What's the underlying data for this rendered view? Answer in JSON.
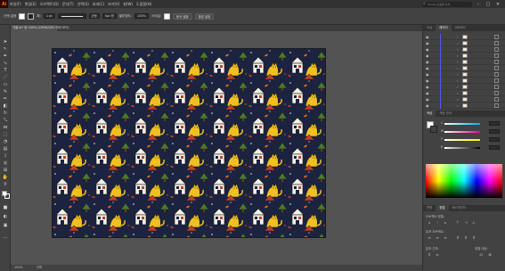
{
  "app": {
    "logo": "Ai",
    "menus": [
      "파일(F)",
      "편집(E)",
      "오브젝트(O)",
      "문자(T)",
      "선택(S)",
      "효과(C)",
      "보기(V)",
      "창(W)",
      "도움말(H)"
    ],
    "search_placeholder": "Adobe 도움말 검색"
  },
  "control_bar": {
    "selection_label": "선택 없음",
    "stroke_label": "획:",
    "stroke_weight": "1 pt",
    "stroke_profile": "균등",
    "brush": "5pt 원",
    "opacity_label": "불투명도:",
    "opacity_value": "100%",
    "style_label": "스타일:",
    "doc_setup_button": "문서 설정",
    "preferences_button": "환경 설정"
  },
  "document": {
    "tab_label": "가을.ai* @ 100% (CMYK/GPU 미리 보기)",
    "zoom": "100%",
    "status_tool": "선택"
  },
  "layers_panel": {
    "tabs": [
      "속성",
      "레이어",
      "아트보드"
    ],
    "active_tab": "레이어",
    "row_count": 12,
    "footer": "12 레이어"
  },
  "color_panel": {
    "tabs": [
      "색상",
      "색상 안내"
    ],
    "channels": [
      "C",
      "M",
      "Y",
      "K"
    ]
  },
  "properties_panel": {
    "tabs": [
      "변형",
      "정렬",
      "패스파인더"
    ],
    "section_labels": [
      "오브젝트 정렬:",
      "분포 오브젝트:",
      "분포 간격:",
      "정렬 대상:"
    ]
  },
  "colors": {
    "pattern_bg": "#1c2340",
    "house_white": "#f4f0e6",
    "cat_yellow": "#f0c020",
    "tree_green": "#4a7a2a",
    "roof_red": "#c0402a",
    "accent_orange": "#e06a20"
  }
}
